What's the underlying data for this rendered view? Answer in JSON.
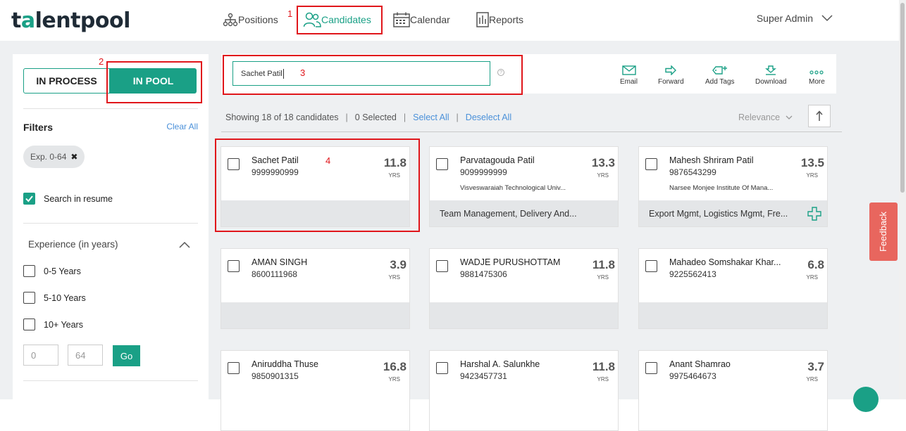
{
  "app": {
    "logo_prefix": "t",
    "logo_accent": "a",
    "logo_rest": "lentpool",
    "brand_color": "#1aa086"
  },
  "nav": {
    "positions": "Positions",
    "candidates": "Candidates",
    "calendar": "Calendar",
    "reports": "Reports",
    "user": "Super Admin"
  },
  "annotations": [
    "1",
    "2",
    "3",
    "4"
  ],
  "sidebar": {
    "in_process": "IN PROCESS",
    "in_pool": "IN POOL",
    "filters_title": "Filters",
    "clear_all": "Clear All",
    "chip_label": "Exp. 0-64",
    "search_in_resume": "Search in resume",
    "experience_title": "Experience (in years)",
    "exp_options": [
      "0-5 Years",
      "5-10 Years",
      "10+ Years"
    ],
    "min_value": "0",
    "max_value": "64",
    "go_label": "Go"
  },
  "search": {
    "value": "Sachet Patil"
  },
  "actions": {
    "email": "Email",
    "forward": "Forward",
    "add_tags": "Add Tags",
    "download": "Download",
    "more": "More"
  },
  "summary": {
    "showing": "Showing 18 of 18 candidates",
    "selected": "0 Selected",
    "select_all": "Select All",
    "deselect_all": "Deselect All",
    "sort": "Relevance"
  },
  "cards": [
    {
      "name": "Sachet Patil",
      "phone": "9999990999",
      "years": "11.8",
      "yrs_label": "YRS",
      "institute": "",
      "footer": ""
    },
    {
      "name": "Parvatagouda Patil",
      "phone": "9099999999",
      "years": "13.3",
      "yrs_label": "YRS",
      "institute": "Visveswaraiah Technological Univ...",
      "footer": "Team Management, Delivery And..."
    },
    {
      "name": "Mahesh Shriram Patil",
      "phone": "9876543299",
      "years": "13.5",
      "yrs_label": "YRS",
      "institute": "Narsee Monjee Institute Of Mana...",
      "footer": "Export Mgmt, Logistics Mgmt, Fre..."
    },
    {
      "name": "AMAN SINGH",
      "phone": "8600111968",
      "years": "3.9",
      "yrs_label": "YRS",
      "institute": "",
      "footer": ""
    },
    {
      "name": "WADJE PURUSHOTTAM",
      "phone": "9881475306",
      "years": "11.8",
      "yrs_label": "YRS",
      "institute": "",
      "footer": ""
    },
    {
      "name": "Mahadeo Somshakar Khar...",
      "phone": "9225562413",
      "years": "6.8",
      "yrs_label": "YRS",
      "institute": "",
      "footer": ""
    },
    {
      "name": "Aniruddha Thuse",
      "phone": "9850901315",
      "years": "16.8",
      "yrs_label": "YRS",
      "institute": "",
      "footer": ""
    },
    {
      "name": "Harshal A. Salunkhe",
      "phone": "9423457731",
      "years": "11.8",
      "yrs_label": "YRS",
      "institute": "",
      "footer": ""
    },
    {
      "name": "Anant Shamrao",
      "phone": "9975464673",
      "years": "3.7",
      "yrs_label": "YRS",
      "institute": "",
      "footer": ""
    }
  ],
  "feedback": "Feedback"
}
